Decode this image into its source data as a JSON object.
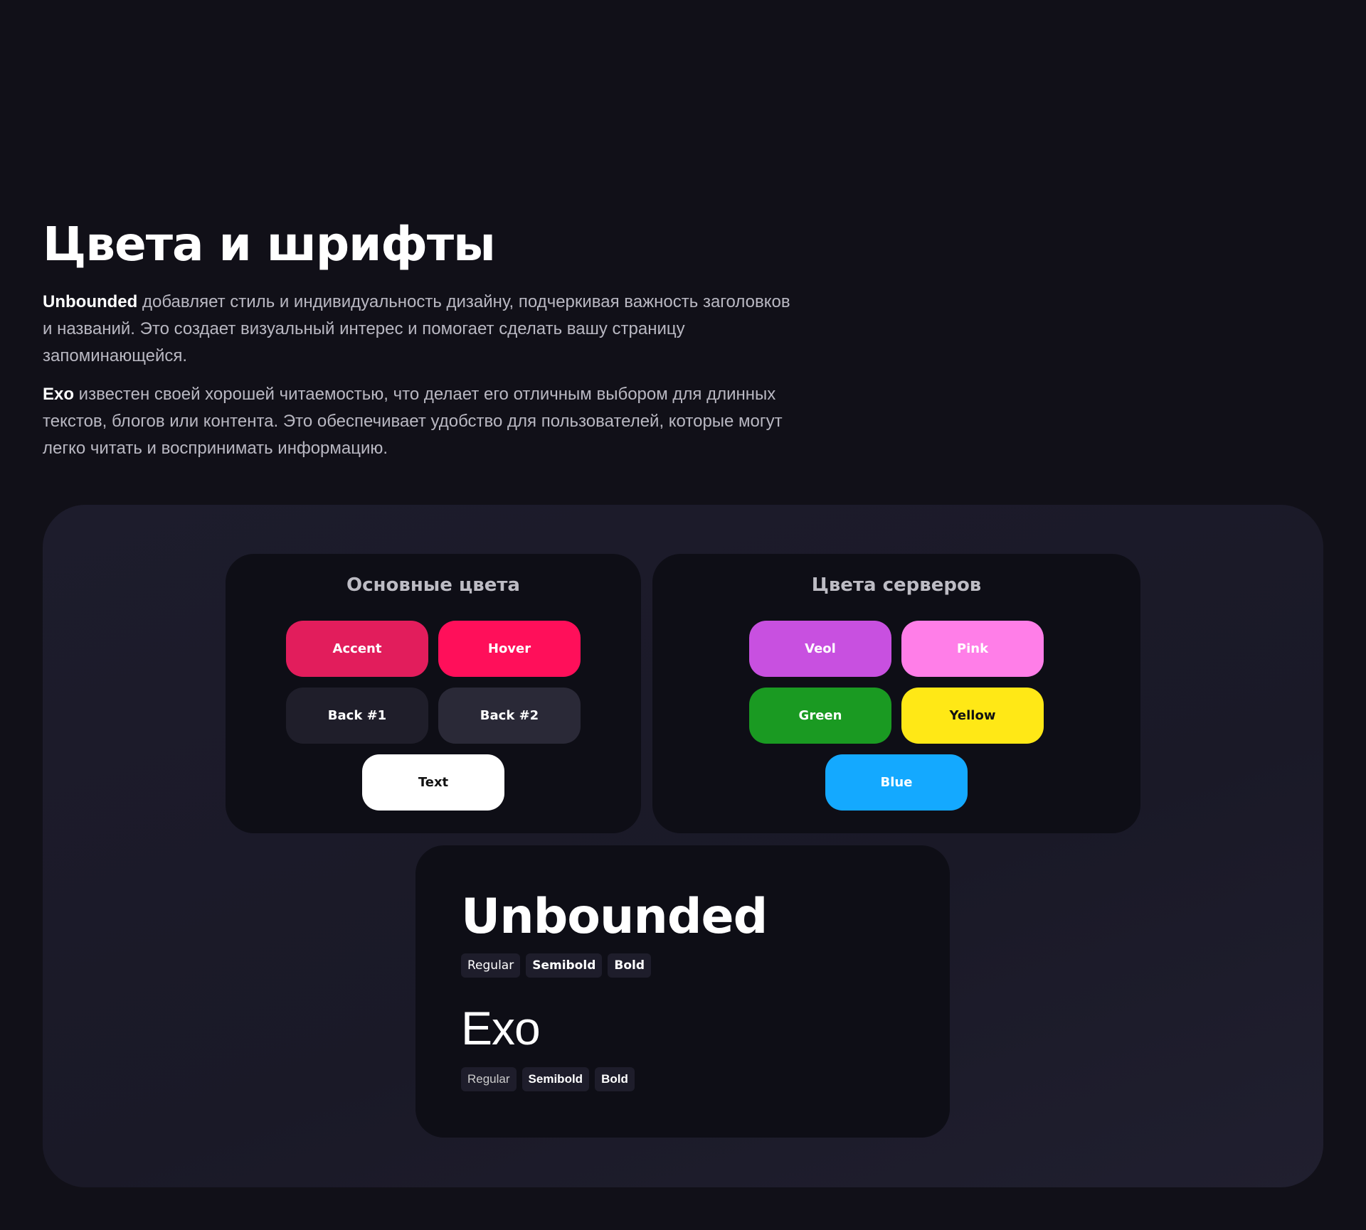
{
  "header": {
    "title": "Цвета и шрифты"
  },
  "intro": [
    {
      "bold": "Unbounded",
      "text": " добавляет стиль и индивидуальность дизайну, подчеркивая важность заголовков и названий. Это создает визуальный интерес и помогает сделать вашу страницу запоминающейся."
    },
    {
      "bold": "Exo",
      "text": " известен своей хорошей читаемостью, что делает его отличным выбором для длинных текстов, блогов или контента. Это обеспечивает удобство для пользователей, которые могут легко читать и воспринимать информацию."
    }
  ],
  "main_colors": {
    "title": "Основные цвета",
    "swatches": [
      {
        "label": "Accent",
        "color": "#e21d5c",
        "text": "#ffffff"
      },
      {
        "label": "Hover",
        "color": "#ff0f5a",
        "text": "#ffffff"
      },
      {
        "label": "Back #1",
        "color": "#1f1e2a",
        "text": "#ffffff"
      },
      {
        "label": "Back #2",
        "color": "#2a2937",
        "text": "#ffffff"
      },
      {
        "label": "Text",
        "color": "#ffffff",
        "text": "#111111"
      }
    ]
  },
  "server_colors": {
    "title": "Цвета серверов",
    "swatches": [
      {
        "label": "Veol",
        "color": "#c850e0",
        "text": "#ffffff"
      },
      {
        "label": "Pink",
        "color": "#ff7ee8",
        "text": "#ffffff"
      },
      {
        "label": "Green",
        "color": "#1a9a22",
        "text": "#ffffff"
      },
      {
        "label": "Yellow",
        "color": "#ffe816",
        "text": "#111111"
      },
      {
        "label": "Blue",
        "color": "#14a9ff",
        "text": "#ffffff"
      }
    ]
  },
  "fonts": [
    {
      "name": "Unbounded",
      "weights": [
        "Regular",
        "Semibold",
        "Bold"
      ]
    },
    {
      "name": "Exo",
      "weights": [
        "Regular",
        "Semibold",
        "Bold"
      ]
    }
  ]
}
